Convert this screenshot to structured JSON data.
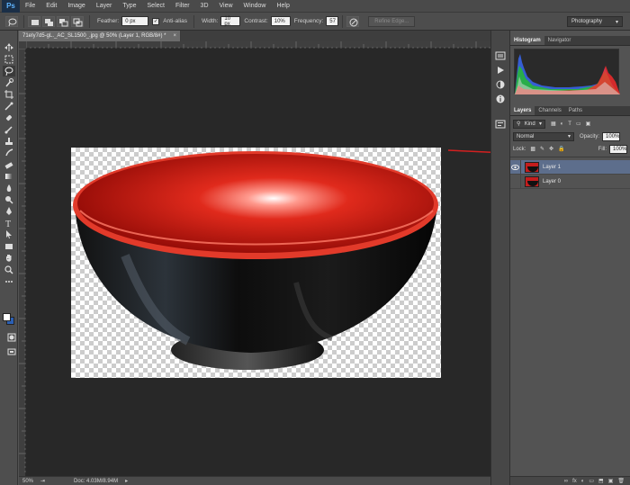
{
  "app": {
    "logo": "Ps"
  },
  "menu": [
    "File",
    "Edit",
    "Image",
    "Layer",
    "Type",
    "Select",
    "Filter",
    "3D",
    "View",
    "Window",
    "Help"
  ],
  "options": {
    "feather_label": "Feather:",
    "feather_value": "0 px",
    "antialias_label": "Anti-alias",
    "antialias_checked": "✓",
    "width_label": "Width:",
    "width_value": "10 px",
    "contrast_label": "Contrast:",
    "contrast_value": "10%",
    "frequency_label": "Frequency:",
    "frequency_value": "57",
    "refine_edge_label": "Refine Edge...",
    "workspace": "Photography"
  },
  "document": {
    "tab_title": "71eIy7d5-gL._AC_SL1500_.jpg @ 50% (Layer 1, RGB/8#) *",
    "close": "×",
    "zoom": "50%",
    "doc_size": "Doc: 4.03M/8.94M"
  },
  "panels": {
    "tabs_top": [
      "Histogram",
      "Navigator"
    ],
    "tabs_layers": [
      "Layers",
      "Channels",
      "Paths"
    ],
    "kind_label": "Kind",
    "blend_mode": "Normal",
    "opacity_label": "Opacity:",
    "opacity_value": "100%",
    "lock_label": "Lock:",
    "fill_label": "Fill:",
    "fill_value": "100%",
    "layers": [
      {
        "name": "Layer 1",
        "selected": true
      },
      {
        "name": "Layer 0",
        "selected": false
      }
    ],
    "bottom_icons": [
      "∞",
      "fx",
      "◐",
      "▭",
      "⬒",
      "▣",
      "🗑"
    ]
  },
  "colors": {
    "foreground": "#ffffff",
    "background": "#2b5fb3",
    "accent_arrow": "#d42020"
  }
}
